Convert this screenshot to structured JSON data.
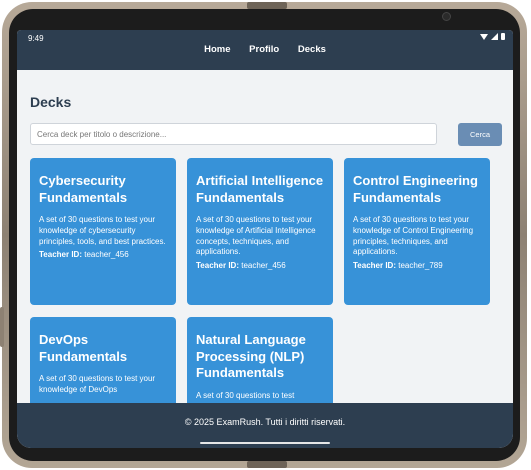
{
  "status_bar": {
    "time": "9:49"
  },
  "nav": {
    "items": [
      {
        "label": "Home"
      },
      {
        "label": "Profilo"
      },
      {
        "label": "Decks"
      }
    ]
  },
  "page": {
    "title": "Decks"
  },
  "search": {
    "placeholder": "Cerca deck per titolo o descrizione...",
    "button_label": "Cerca"
  },
  "decks": [
    {
      "title": "Cybersecurity Fundamentals",
      "description": "A set of 30 questions to test your knowledge of cybersecurity principles, tools, and best practices.",
      "teacher_label": "Teacher ID:",
      "teacher_id": "teacher_456"
    },
    {
      "title": "Artificial Intelligence Fundamentals",
      "description": "A set of 30 questions to test your knowledge of Artificial Intelligence concepts, techniques, and applications.",
      "teacher_label": "Teacher ID:",
      "teacher_id": "teacher_456"
    },
    {
      "title": "Control Engineering Fundamentals",
      "description": "A set of 30 questions to test your knowledge of Control Engineering principles, techniques, and applications.",
      "teacher_label": "Teacher ID:",
      "teacher_id": "teacher_789"
    },
    {
      "title": "DevOps Fundamentals",
      "description": "A set of 30 questions to test your knowledge of DevOps",
      "teacher_label": "",
      "teacher_id": ""
    },
    {
      "title": "Natural Language Processing (NLP) Fundamentals",
      "description": "A set of 30 questions to test",
      "teacher_label": "",
      "teacher_id": ""
    }
  ],
  "footer": {
    "text": "© 2025 ExamRush. Tutti i diritti riservati."
  },
  "colors": {
    "header_bg": "#2d3e50",
    "card_bg": "#3792d8",
    "search_button_bg": "#6a8db4",
    "page_bg": "#f1f3f5"
  }
}
